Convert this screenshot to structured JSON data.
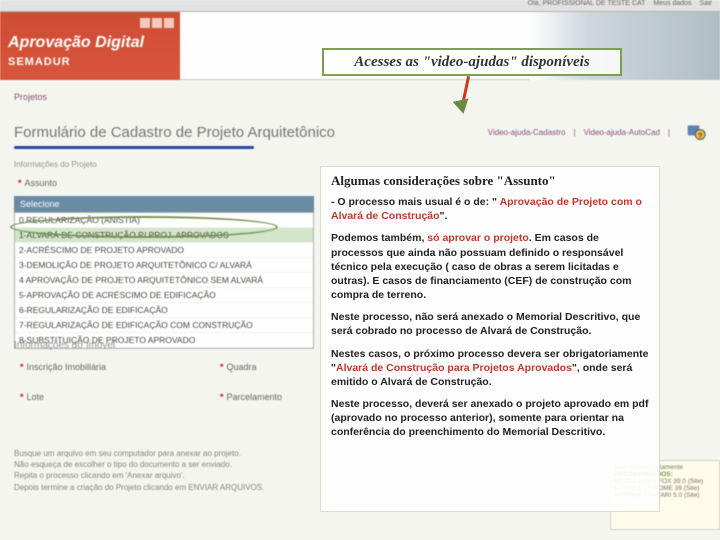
{
  "topbar": {
    "greeting": "Olá, PROFISSIONAL DE TESTE CAT",
    "meusdados": "Meus dados",
    "sair": "Sair"
  },
  "header": {
    "app_title": "Aprovação Digital",
    "org": "SEMADUR"
  },
  "callout_top": "Acesses as \"video-ajudas\" disponíveis",
  "nav": {
    "projetos": "Projetos"
  },
  "form_title": "Formulário de Cadastro de Projeto Arquitetônico",
  "video_links": {
    "cad": "Video-ajuda-Cadastro",
    "autocad": "Video-ajuda-AutoCad"
  },
  "section_info": "Informações do Projeto",
  "assunto_label": "Assunto",
  "dropdown": {
    "selected": "Selecione",
    "items": [
      "0 REGULARIZAÇÃO (ANISTIA)",
      "1-ALVARÁ DE CONSTRUÇÃO P/ PROJ. APROVADOS",
      "2-ACRÉSCIMO DE PROJETO APROVADO",
      "3-DEMOLIÇÃO DE PROJETO ARQUITETÔNICO C/ ALVARÁ",
      "4 APROVAÇÃO DE PROJETO ARQUITETÔNICO SEM ALVARÁ",
      "5-APROVAÇÃO DE ACRÉSCIMO DE EDIFICAÇÃO",
      "6-REGULARIZAÇÃO DE EDIFICAÇÃO",
      "7-REGULARIZAÇÃO DE EDIFICAÇÃO COM CONSTRUÇÃO",
      "8-SUBSTITUIÇÃO DE PROJETO APROVADO"
    ]
  },
  "section_imovel": "Informações do Imóvel",
  "fields": {
    "inscricao": "Inscrição Imobiliária",
    "quadra": "Quadra",
    "lote": "Lote",
    "parcelamento": "Parcelamento"
  },
  "attach_text": {
    "l1": "Busque um arquivo em seu computador para anexar ao projeto.",
    "l2": "Não esqueça de escolher o tipo do documento a ser enviado.",
    "l3": "Repita o processo clicando em 'Anexar arquivo'.",
    "l4": "Depois termine a criação do Projeto clicando em ENVIAR ARQUIVOS."
  },
  "considerations": {
    "title": "Algumas considerações sobre \"Assunto\"",
    "p1_a": "- O processo mais usual é o de: \" ",
    "p1_b": "Aprovação de Projeto com o Alvará de Construção",
    "p1_c": "\".",
    "p2_a": "Podemos também, ",
    "p2_b": "só aprovar o projeto",
    "p2_c": ". Em casos de processos que ainda não possuam definido o responsável técnico pela execução ( caso de obras a serem licitadas e outras). E casos de financiamento (CEF) de construção com compra de terreno.",
    "p3": "Neste processo, não será anexado o Memorial Descritivo, que será cobrado no processo de Alvará de Construção.",
    "p4_a": "Nestes casos, o próximo processo devera ser obrigatoriamente \"",
    "p4_b": "Alvará de Construção para Projetos Aprovados",
    "p4_c": "\", onde será emitido o Alvará de Construção.",
    "p5": "Neste processo, deverá ser anexado o projeto aprovado em pdf (aprovado no processo anterior), somente para orientar na conferência do preenchimento do Memorial Descritivo."
  },
  "browsers": {
    "hdr": "Navegadores altamente",
    "rec": "RECOMENDADOS:",
    "b1": "MOZILLA FIREFOX 39.0 (Site)",
    "b2": "GOOGLE CHROME 39 (Site)",
    "b3": "INTERNET SAFARI 5.0 (Site)"
  }
}
